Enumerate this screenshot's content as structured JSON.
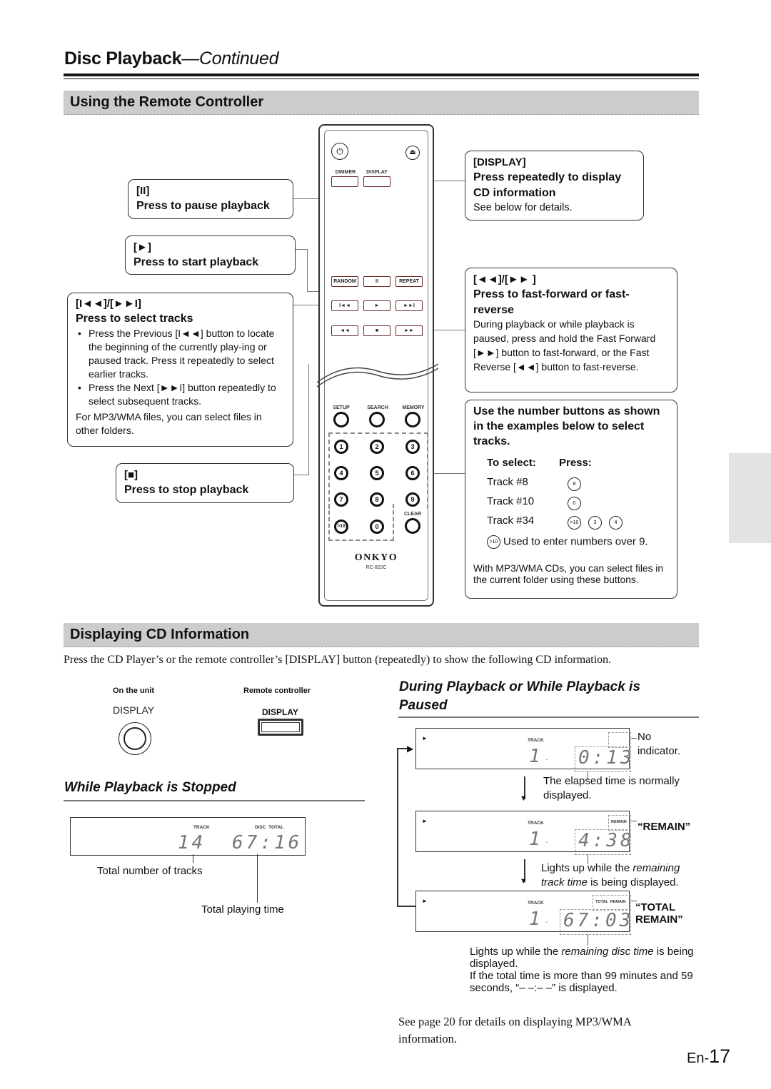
{
  "header": {
    "title": "Disc Playback",
    "title_suffix": "—Continued"
  },
  "section1": {
    "title": "Using the Remote Controller"
  },
  "callouts": {
    "pause": {
      "symbol": "[II]",
      "heading": "Press to pause playback"
    },
    "play": {
      "symbol": "[►]",
      "heading": "Press to start playback"
    },
    "select_tracks": {
      "symbol": "[I◄◄]/[►►I]",
      "heading": "Press to select tracks",
      "bullets": [
        "Press the Previous [I◄◄] button to locate the beginning of the currently play-ing or paused track. Press it repeatedly to select earlier tracks.",
        "Press the Next [►►I] button repeatedly to select subsequent tracks."
      ],
      "note": "For MP3/WMA files, you can select files in other folders."
    },
    "stop": {
      "symbol": "[■]",
      "heading": "Press to stop playback"
    },
    "display": {
      "symbol": "[DISPLAY]",
      "heading": "Press repeatedly to display CD information",
      "text": "See below for details."
    },
    "fast": {
      "symbol": "[◄◄]/[►► ]",
      "heading": "Press to fast-forward or fast-reverse",
      "text": "During playback or while playback is paused, press and hold the Fast Forward [►►] button to fast-forward, or the Fast Reverse [◄◄] button to fast-reverse."
    },
    "number": {
      "heading": "Use the number buttons as shown in the examples below to select tracks.",
      "col_select": "To select:",
      "col_press": "Press:",
      "rows": [
        {
          "track": "Track #8",
          "keys": [
            "8"
          ]
        },
        {
          "track": "Track #10",
          "keys": [
            "0"
          ]
        },
        {
          "track": "Track #34",
          "keys": [
            ">10",
            "3",
            "4"
          ]
        }
      ],
      "gt10_key": ">10",
      "gt10_note": "Used to enter numbers over 9.",
      "mp3_note": "With MP3/WMA CDs, you can select files in the current folder using these buttons."
    }
  },
  "remote": {
    "top_labels": [
      "DIMMER",
      "DISPLAY"
    ],
    "row1": [
      "RANDOM",
      "II",
      "REPEAT"
    ],
    "row2": [
      "I◄◄",
      "►",
      "►►I"
    ],
    "row3": [
      "◄◄",
      "■",
      "►►"
    ],
    "func_labels": [
      "SETUP",
      "SEARCH",
      "MEMORY"
    ],
    "digits": [
      "1",
      "2",
      "3",
      "4",
      "5",
      "6",
      "7",
      "8",
      "9",
      ">10",
      "0"
    ],
    "clear_label": "CLEAR",
    "brand": "ONKYO",
    "model": "RC-822C"
  },
  "section2": {
    "title": "Displaying CD Information",
    "intro": "Press the CD Player’s or the remote controller’s [DISPLAY] button (repeatedly) to show the following CD information.",
    "on_unit_label": "On the unit",
    "on_unit_button": "DISPLAY",
    "remote_label": "Remote controller",
    "remote_button": "DISPLAY"
  },
  "stopped": {
    "title": "While Playback is Stopped",
    "lcd": {
      "track_label": "TRACK",
      "disc_total_label": "DISC  TOTAL",
      "tracks": "14",
      "time": "67:16"
    },
    "label_tracks": "Total number of tracks",
    "label_time": "Total playing time"
  },
  "playing": {
    "title": "During Playback or While Playback is Paused",
    "displays": [
      {
        "track_label": "TRACK",
        "indicator": "",
        "track": "1",
        "time": "0:13",
        "callout": "No indicator.",
        "note": "The elapsed time is normally displayed."
      },
      {
        "track_label": "TRACK",
        "indicator": "REMAIN",
        "track": "1",
        "time": "4:38",
        "callout": "“REMAIN”",
        "note_pre": "Lights up while the ",
        "note_em": "remaining track time",
        "note_post": " is being displayed."
      },
      {
        "track_label": "TRACK",
        "indicator": "TOTAL  REMAIN",
        "track": "1",
        "time": "67:03",
        "callout": "“TOTAL REMAIN”",
        "note_pre": "Lights up while the ",
        "note_em": "remaining disc time",
        "note_post": " is being displayed.",
        "note2": "If the total time is more than 99 minutes and 59 seconds, “– –:– –” is displayed."
      }
    ],
    "see_page": "See page 20 for details on displaying MP3/WMA information."
  },
  "footer": {
    "page_prefix": "En-",
    "page_number": "17"
  }
}
